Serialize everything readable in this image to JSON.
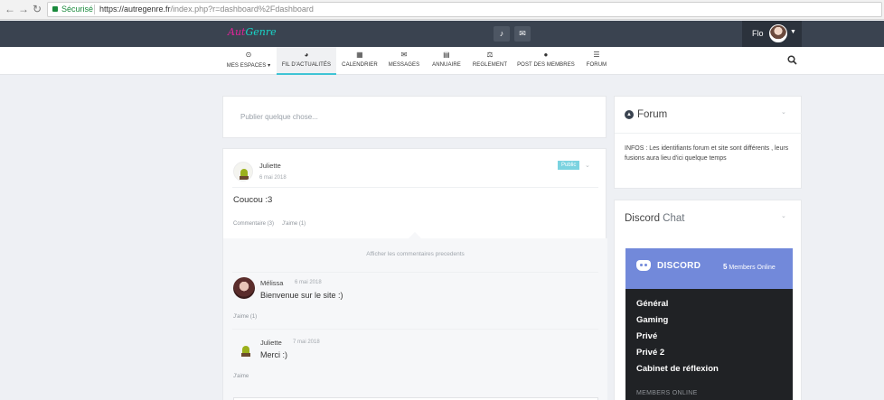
{
  "browser": {
    "secure_label": "Sécurisé",
    "url_base": "https://autregenre.fr",
    "url_path": "/index.php?r=dashboard%2Fdashboard"
  },
  "header": {
    "logo_part1": "Aut",
    "logo_part2": "Genre",
    "bell_icon": "bell-icon",
    "mail_icon": "envelope-icon",
    "username": "Flo"
  },
  "nav": {
    "items": [
      {
        "label": "MES ESPACES ▾",
        "icon": "target-icon",
        "glyph": "⊙"
      },
      {
        "label": "FIL D'ACTUALITÉS",
        "icon": "dashboard-icon",
        "glyph": "◕"
      },
      {
        "label": "CALENDRIER",
        "icon": "calendar-icon",
        "glyph": "▦"
      },
      {
        "label": "MESSAGES",
        "icon": "envelope-icon",
        "glyph": "✉"
      },
      {
        "label": "ANNUAIRE",
        "icon": "book-icon",
        "glyph": "▤"
      },
      {
        "label": "REGLEMENT",
        "icon": "scale-icon",
        "glyph": "⚖"
      },
      {
        "label": "POST DES MEMBRES",
        "icon": "user-icon",
        "glyph": "●"
      },
      {
        "label": "FORUM",
        "icon": "list-icon",
        "glyph": "☰"
      }
    ]
  },
  "composer": {
    "placeholder": "Publier quelque chose..."
  },
  "post": {
    "author": "Juliette",
    "date": "6 mai 2018",
    "visibility": "Public",
    "text": "Coucou :3",
    "comment_link": "Commentaire (3)",
    "like_link": "J'aime (1)",
    "previous_comments": "Afficher les commentaires precedents"
  },
  "comments": [
    {
      "author": "Mélissa",
      "date": "6 mai 2018",
      "text": "Bienvenue sur le site :)",
      "like": "J'aime (1)"
    },
    {
      "author": "Juliette",
      "date": "7 mai 2018",
      "text": "Merci :)",
      "like": "J'aime"
    }
  ],
  "forum_card": {
    "title": "Forum",
    "text": "INFOS : Les identifiants forum et site sont différents , leurs fusions aura lieu d'ici quelque temps"
  },
  "discord_card": {
    "title_bold": "Discord",
    "title_light": " Chat",
    "wordmark": "DISCORD",
    "members_count": "5",
    "members_label": " Members Online",
    "channels": [
      "Général",
      "Gaming",
      "Privé",
      "Privé 2",
      "Cabinet de réflexion"
    ],
    "members_online_heading": "MEMBERS ONLINE"
  },
  "colors": {
    "topbar": "#3a4350",
    "accent": "#3fc4d5",
    "discord": "#7289da"
  }
}
